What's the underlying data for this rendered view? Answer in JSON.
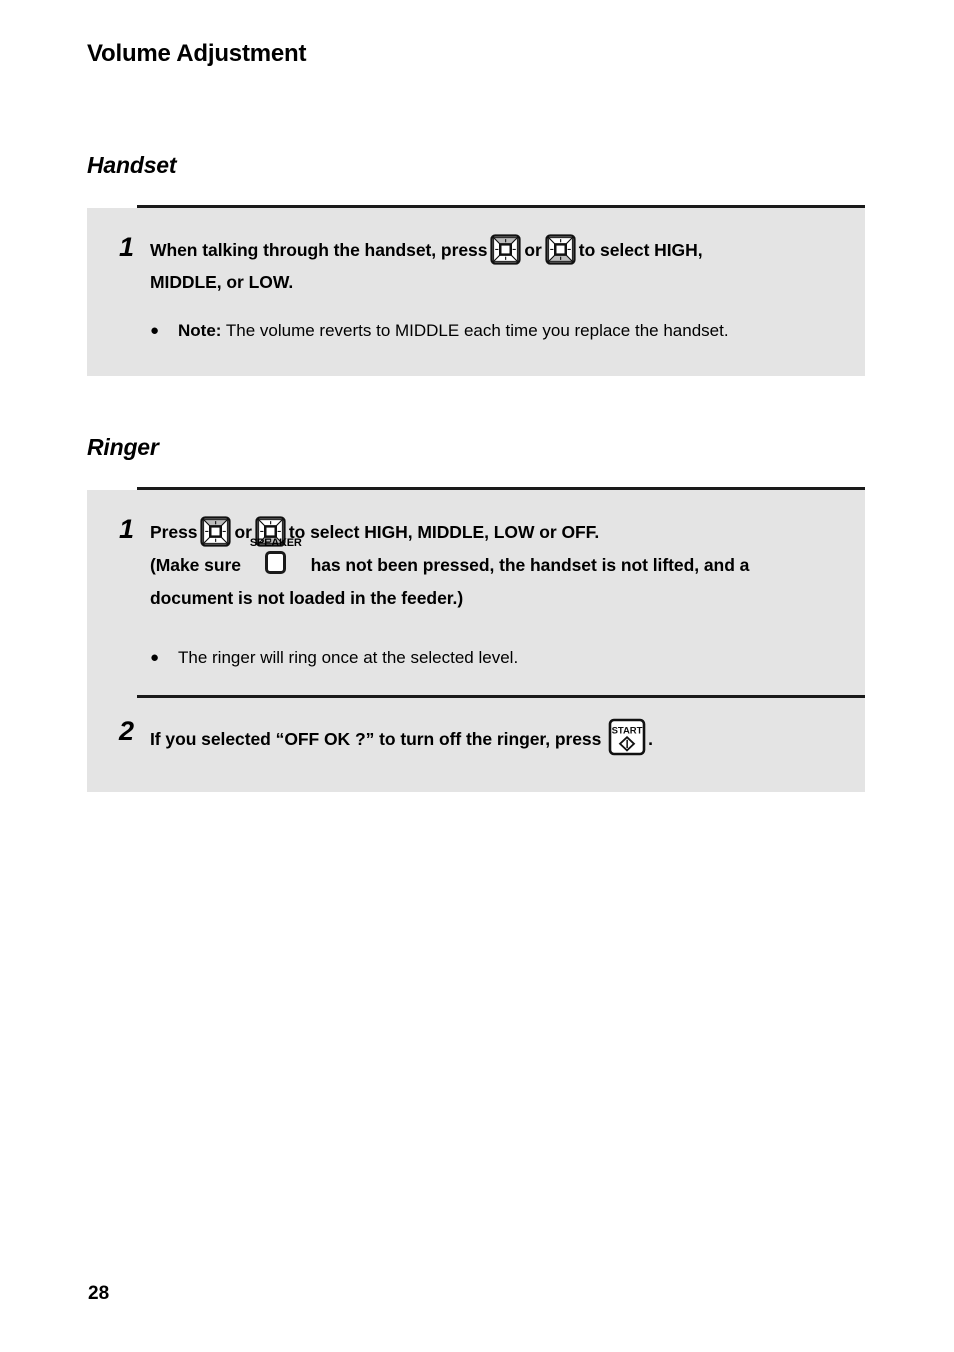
{
  "document": {
    "title": "Volume Adjustment",
    "page_number": "28"
  },
  "sections": [
    {
      "heading": "Handset",
      "steps": [
        {
          "number": "1",
          "line1_before": "When talking through the handset, press",
          "icon1": "volume-up-key-icon",
          "conjunction": "or",
          "icon2": "volume-down-key-icon",
          "line1_after": "to select HIGH,",
          "line2": "MIDDLE, or LOW.",
          "bullets": [
            {
              "label": "Note:",
              "text": "The volume reverts to MIDDLE each time you replace the handset."
            }
          ]
        }
      ]
    },
    {
      "heading": "Ringer",
      "steps": [
        {
          "number": "1",
          "line1_before": "Press",
          "icon1": "volume-up-key-icon",
          "conjunction": "or",
          "icon2": "volume-down-key-icon",
          "line1_after": "to select HIGH, MIDDLE, LOW or OFF.",
          "line2_before": "(Make sure",
          "speaker_key_label": "SPEAKER",
          "line2_after": "has not been pressed, the handset is not lifted, and a",
          "line3": "document is not loaded in the feeder.)",
          "bullets": [
            {
              "label": "",
              "text": "The ringer will ring once at the selected level."
            }
          ]
        },
        {
          "number": "2",
          "line1_before": "If you selected “OFF OK ?” to turn off the ringer, press",
          "start_key_label": "START",
          "line1_after": "."
        }
      ]
    }
  ],
  "colors": {
    "panel_background": "#e4e4e4",
    "rule": "#1a1a1a",
    "text": "#000000",
    "page_background": "#ffffff",
    "icon_shade": "#bcbcbc"
  }
}
